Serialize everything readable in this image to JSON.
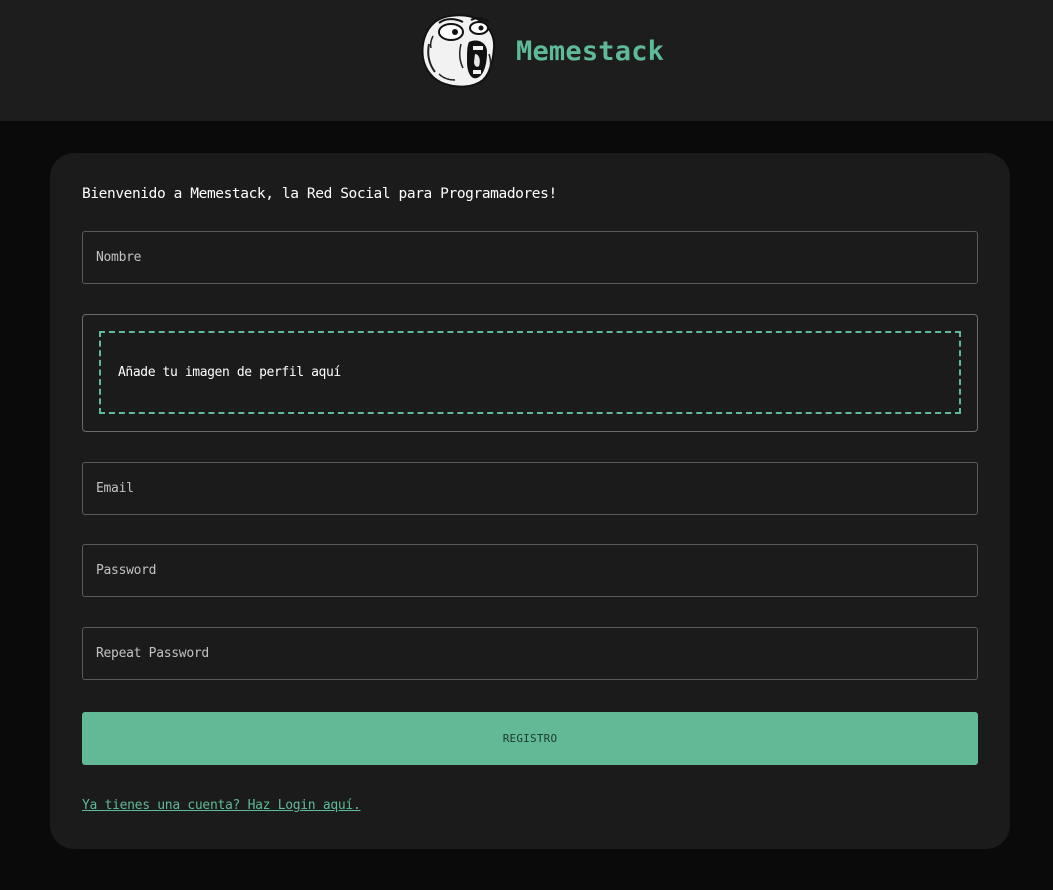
{
  "header": {
    "brand_name": "Memestack",
    "logo_icon": "troll-face-icon"
  },
  "form": {
    "welcome_text": "Bienvenido a Memestack, la Red Social para Programadores!",
    "name_placeholder": "Nombre",
    "avatar_dropzone_label": "Añade tu imagen de perfil aquí",
    "email_placeholder": "Email",
    "password_placeholder": "Password",
    "repeat_password_placeholder": "Repeat Password",
    "submit_label": "REGISTRO",
    "login_link_text": "Ya tienes una cuenta? Haz Login aquí."
  },
  "colors": {
    "accent": "#5fba97",
    "header_bg": "#1d1d1d",
    "page_bg": "#0a0a0a",
    "card_bg": "#1b1b1b"
  }
}
